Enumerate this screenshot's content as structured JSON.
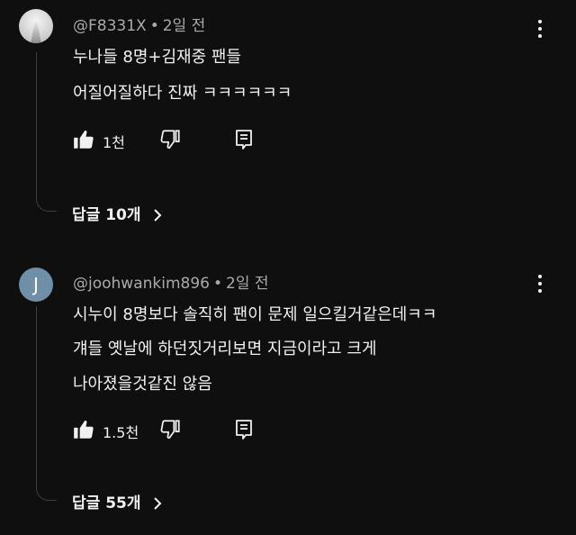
{
  "comments": [
    {
      "author": "@F8331X",
      "separator": "•",
      "time": "2일 전",
      "avatar_icon": "landscape-photo-avatar",
      "lines": [
        "누나들 8명+김재중 팬들",
        "어질어질하다 진짜 ㅋㅋㅋㅋㅋㅋ"
      ],
      "likes": "1천",
      "replies_label": "답글 10개"
    },
    {
      "author": "@joohwankim896",
      "separator": "•",
      "time": "2일 전",
      "avatar_letter": "J",
      "avatar_color": "#6f8fa8",
      "lines": [
        "시누이 8명보다 솔직히 팬이 문제 일으킬거같은데ㅋㅋ",
        "걔들 옛날에 하던짓거리보면 지금이라고 크게",
        "나아졌을것같진 않음"
      ],
      "likes": "1.5천",
      "replies_label": "답글 55개"
    }
  ],
  "icons": [
    "more-vert-icon",
    "thumbs-up-icon",
    "thumbs-down-icon",
    "reply-comment-icon",
    "chevron-right-icon"
  ],
  "colors": {
    "background": "#0f0f0f",
    "text": "#f1f1f1",
    "secondary_text": "#aaaaaa",
    "thread_line": "#3f3f3f"
  }
}
